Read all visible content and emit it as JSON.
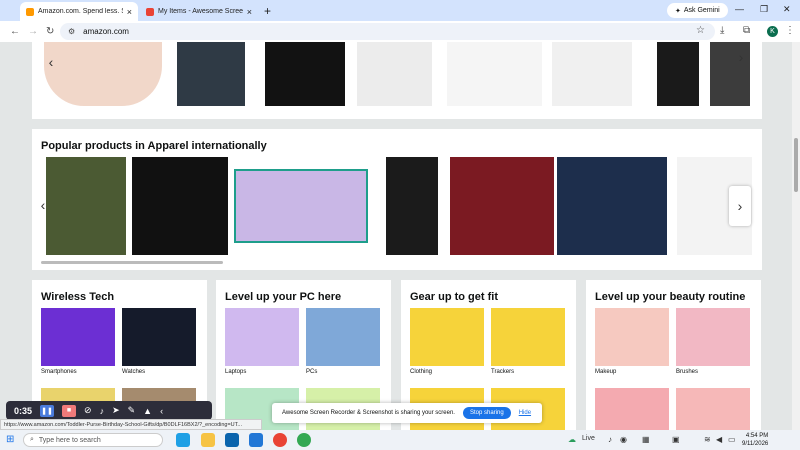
{
  "browser": {
    "tabs": [
      {
        "title": "Amazon.com. Spend less. Smile",
        "color": "#ff9900",
        "active": true
      },
      {
        "title": "My Items - Awesome Screensh",
        "color": "#e94335",
        "active": false
      }
    ],
    "new_tab": "+",
    "gemini": "Ask Gemini",
    "url": "amazon.com",
    "profile_initial": "K"
  },
  "page": {
    "popular_title": "Popular products in Apparel internationally",
    "cards": [
      {
        "title": "Wireless Tech",
        "items": [
          "Smartphones",
          "Watches"
        ]
      },
      {
        "title": "Level up your PC here",
        "items": [
          "Laptops",
          "PCs"
        ]
      },
      {
        "title": "Gear up to get fit",
        "items": [
          "Clothing",
          "Trackers"
        ]
      },
      {
        "title": "Level up your beauty routine",
        "items": [
          "Makeup",
          "Brushes"
        ]
      }
    ]
  },
  "recorder": {
    "time": "0:35"
  },
  "share_bar": {
    "text": "Awesome Screen Recorder & Screenshot is sharing your screen.",
    "stop": "Stop sharing",
    "hide": "Hide"
  },
  "status_url": "https://www.amazon.com/Toddler-Purse-Birthday-School-Gifts/dp/B0DLF16BX2/?_encoding=UT...",
  "taskbar": {
    "search_placeholder": "Type here to search",
    "live": "Live",
    "time": "4:54 PM",
    "date": "9/11/2026"
  }
}
